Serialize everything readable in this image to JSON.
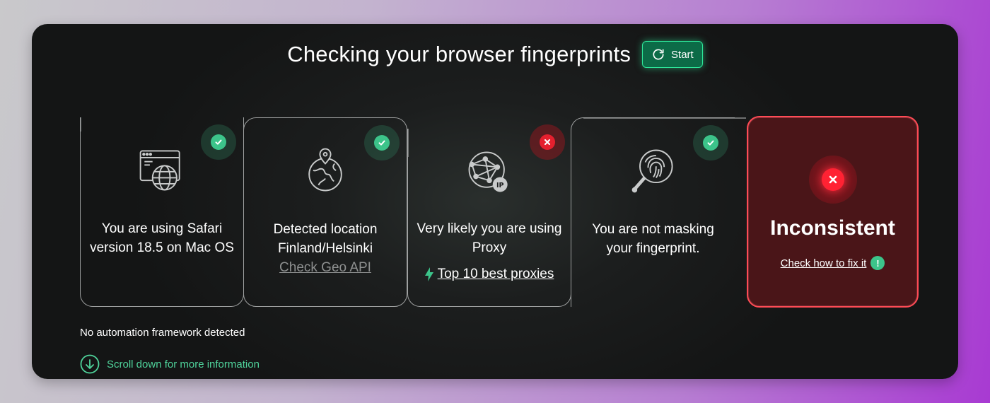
{
  "header": {
    "title": "Checking your browser fingerprints",
    "start_label": "Start"
  },
  "cards": [
    {
      "icon": "browser-globe-icon",
      "status": "ok",
      "text": "You are using Safari version 18.5 on Mac OS"
    },
    {
      "icon": "globe-location-icon",
      "status": "ok",
      "line1": "Detected location",
      "line2": "Finland/Helsinki",
      "link": "Check Geo API"
    },
    {
      "icon": "network-ip-icon",
      "status": "fail",
      "text": "Very likely you are using Proxy",
      "link": "Top 10 best proxies"
    },
    {
      "icon": "fingerprint-search-icon",
      "status": "ok",
      "text": "You are not masking your fingerprint."
    }
  ],
  "result": {
    "label": "Inconsistent",
    "fix_link": "Check how to fix it",
    "fix_icon_glyph": "!"
  },
  "footer": {
    "automation": "No automation framework detected",
    "scroll_hint": "Scroll down for more information"
  },
  "colors": {
    "accent_green": "#3cc48a",
    "error_red": "#e5202e",
    "result_bg": "#4a1518"
  }
}
